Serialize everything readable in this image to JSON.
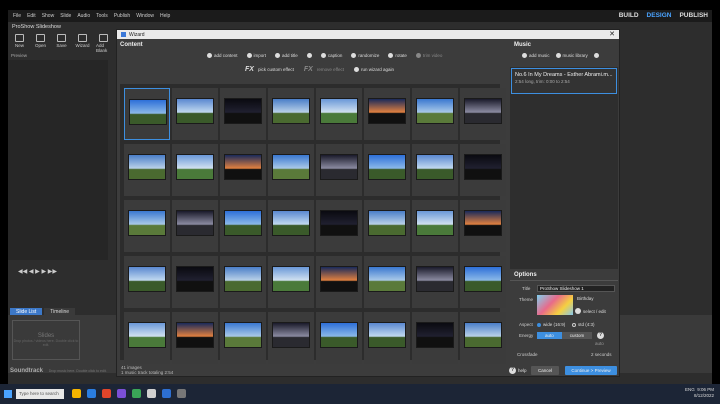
{
  "menu": [
    "File",
    "Edit",
    "Show",
    "Slide",
    "Audio",
    "Tools",
    "Publish",
    "Window",
    "Help"
  ],
  "modes": [
    "BUILD",
    "DESIGN",
    "PUBLISH"
  ],
  "project_title": "ProShow Slideshow",
  "toolbar": [
    "New",
    "Open",
    "Save",
    "Wizard",
    "Add Blank"
  ],
  "preview_label": "Preview",
  "player": "◀◀  ◀  ▶  ▶  ▶▶",
  "tabs": [
    "Slide List",
    "Timeline"
  ],
  "slides_box": {
    "title": "Slides",
    "sub": "Drop photos / videos here. Double click to edit."
  },
  "soundtrack": {
    "label": "Soundtrack",
    "hint": "Drop music here. Double click to edit."
  },
  "wizard": {
    "title": "Wizard",
    "content_heading": "Content",
    "content_tools": [
      "add content",
      "import",
      "add title",
      "",
      "caption",
      "randomize",
      "rotate",
      "trim video"
    ],
    "fx_tools": [
      "pick custom effect",
      "remove effect",
      "run wizard again"
    ],
    "footer": [
      "41 images",
      "1 music track totaling 2:54"
    ],
    "music_heading": "Music",
    "music_tools": [
      "add music",
      "music library"
    ],
    "track": {
      "name": "No.6 In My Dreams - Esther Abrami.m...",
      "info": "2:54 long, trim: 0:00 to 2:54"
    },
    "options": {
      "heading": "Options",
      "title_label": "Title",
      "title_value": "ProShow Slideshow 1",
      "theme_label": "Theme",
      "theme_name": "Birthday",
      "select_edit": "select / edit",
      "aspect_label": "Aspect",
      "aspect_opts": [
        "wide (16:9)",
        "std (4:3)"
      ],
      "energy_label": "Energy",
      "energy_opts": [
        "auto",
        "custom"
      ],
      "energy_sub": "auto",
      "crossfade_label": "Crossfade",
      "crossfade_value": "2 seconds"
    },
    "help": "help",
    "cancel": "Cancel",
    "continue": "Continue > Preview"
  },
  "taskbar": {
    "search": "Type here to search",
    "time": "9:06 PM",
    "date": "8/12/2022",
    "lang": "ENG"
  }
}
